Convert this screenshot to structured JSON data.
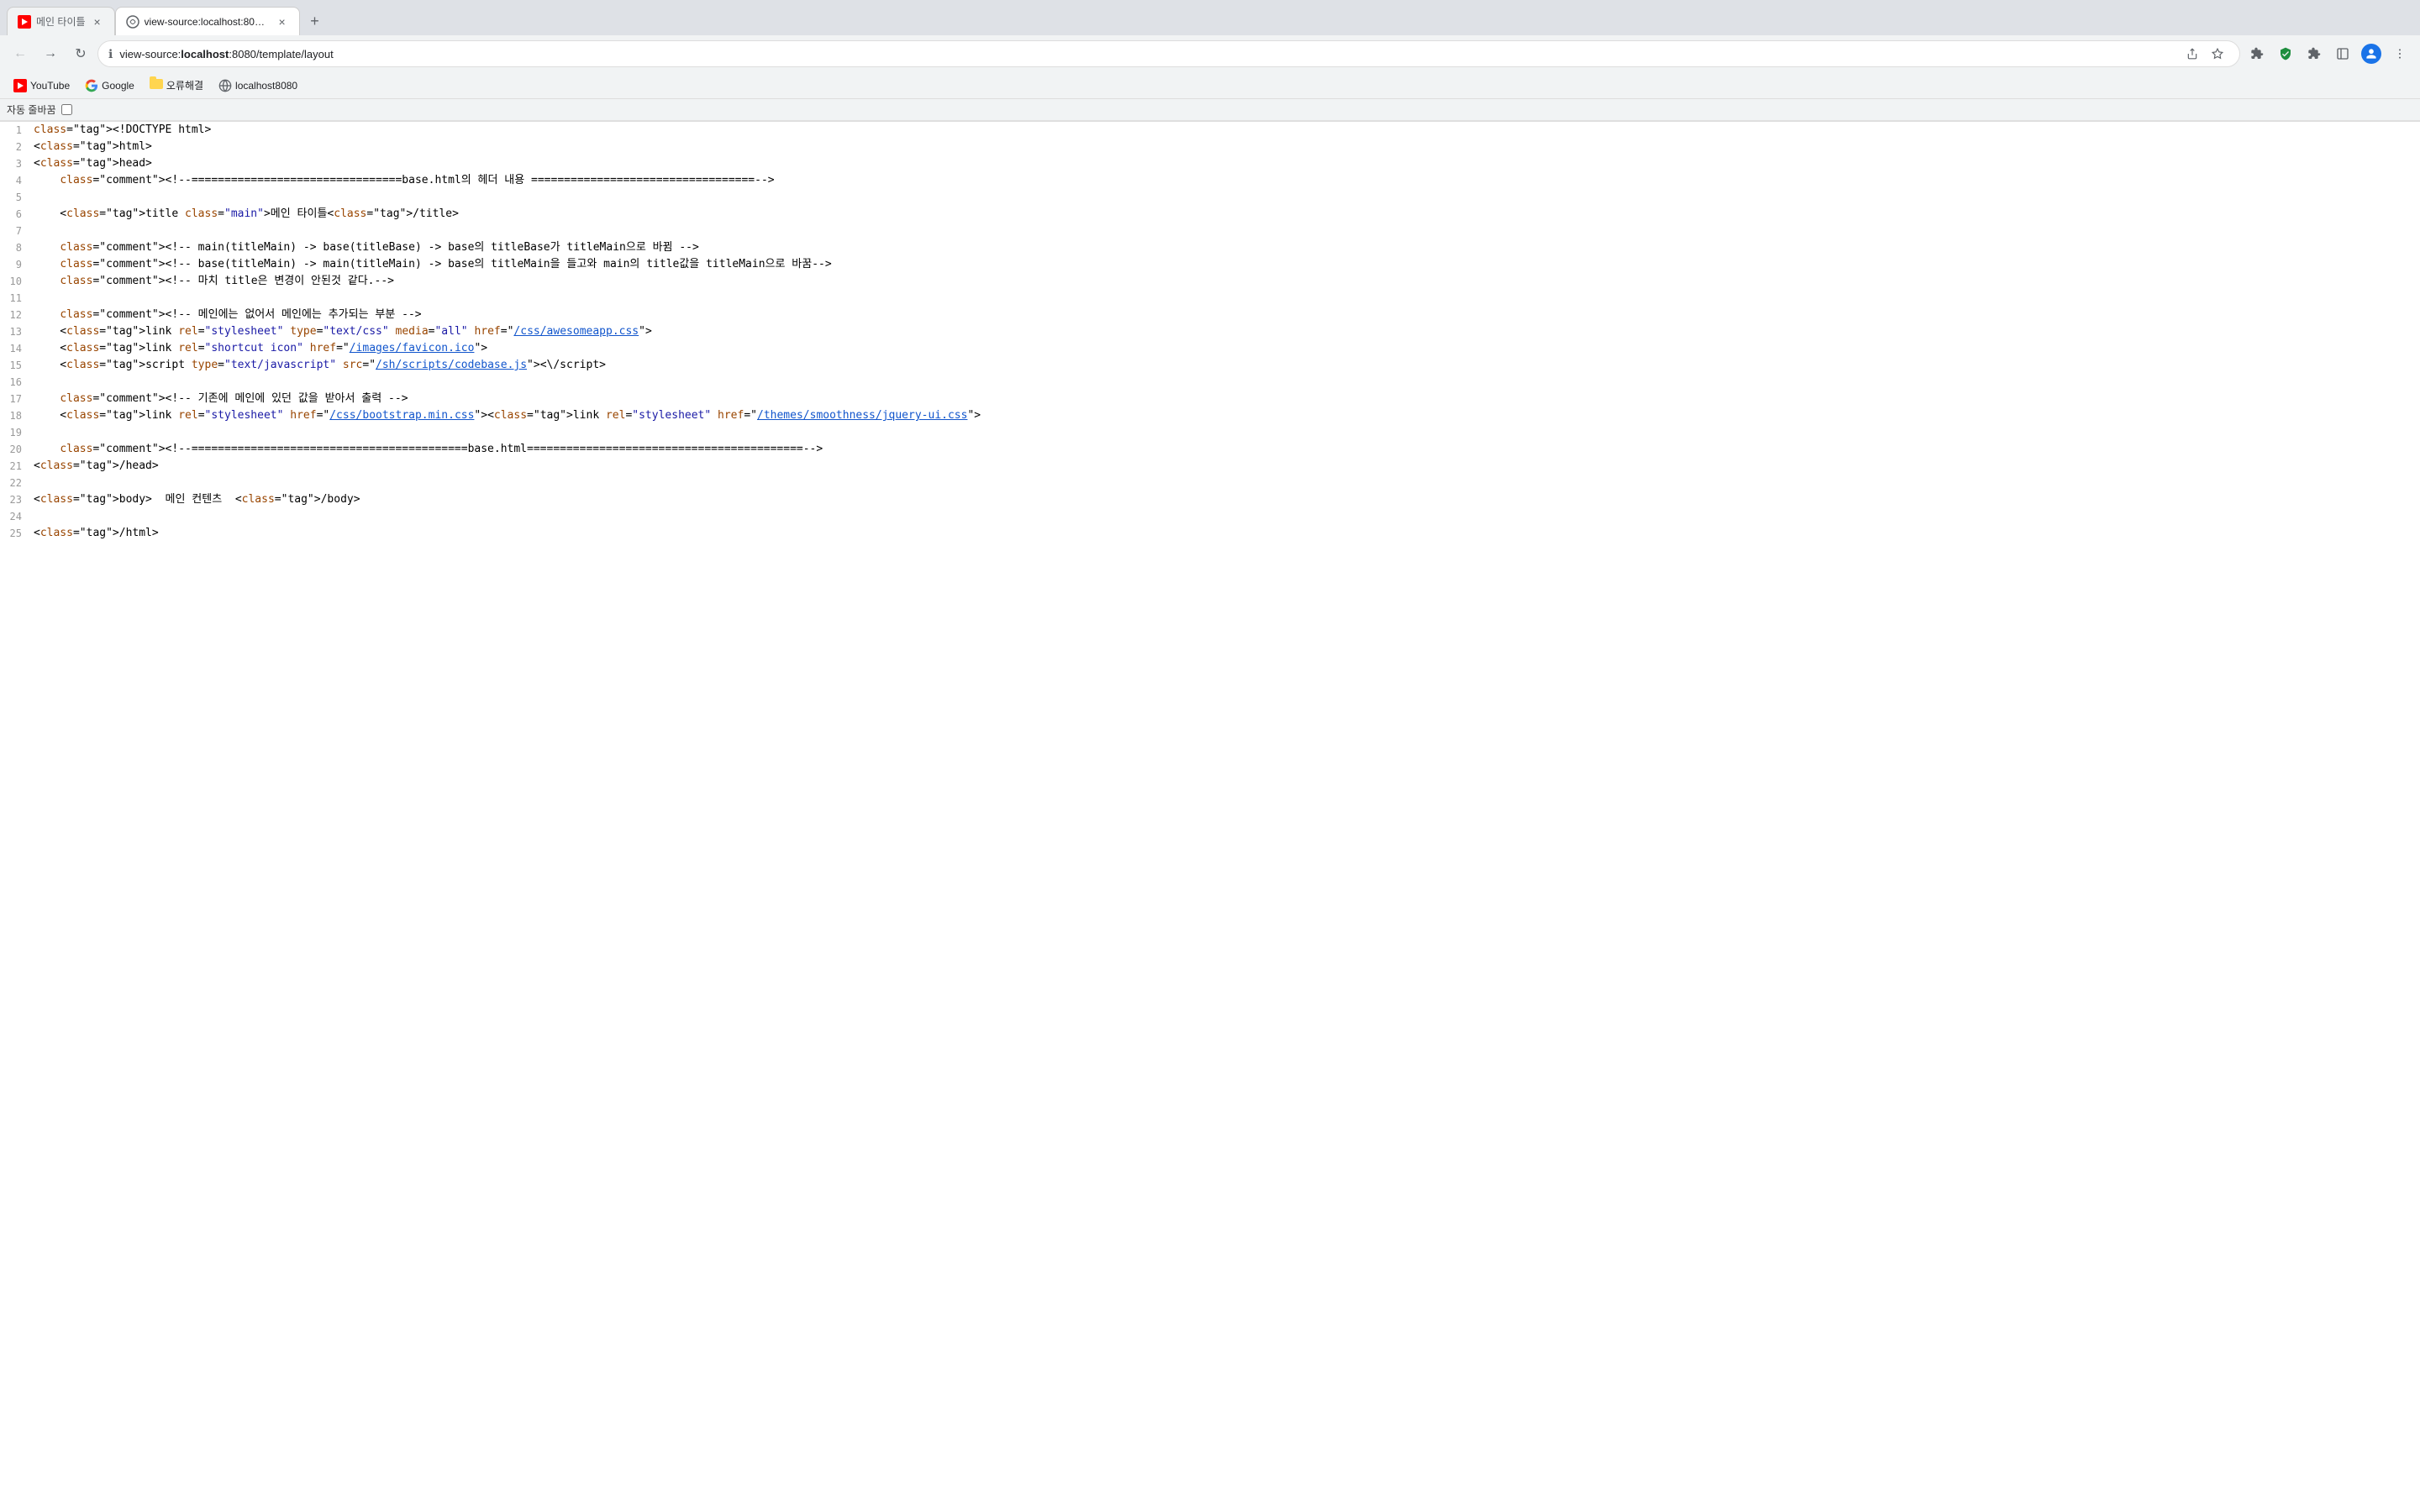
{
  "browser": {
    "tabs": [
      {
        "id": "tab1",
        "title": "메인 타이틀",
        "favicon_type": "youtube",
        "active": false,
        "url": ""
      },
      {
        "id": "tab2",
        "title": "view-source:localhost:8080/t...",
        "favicon_type": "viewsource",
        "active": true,
        "url": "view-source:localhost:8080/template/layout"
      }
    ],
    "address_bar": {
      "prefix": "view-source:",
      "hostname": "localhost",
      "path": ":8080/template/layout"
    },
    "bookmarks": [
      {
        "label": "YouTube",
        "favicon_type": "youtube"
      },
      {
        "label": "Google",
        "favicon_type": "google"
      },
      {
        "label": "오류해결",
        "favicon_type": "folder"
      },
      {
        "label": "localhost8080",
        "favicon_type": "localhost"
      }
    ],
    "autowrap": {
      "label": "자동 줄바꿈",
      "checked": false
    }
  },
  "source": {
    "lines": [
      {
        "num": 1,
        "content": "<!DOCTYPE html>"
      },
      {
        "num": 2,
        "content": "<html>"
      },
      {
        "num": 3,
        "content": "<head>"
      },
      {
        "num": 4,
        "content": "    <!--================================base.html의 헤더 내용 ==================================-->"
      },
      {
        "num": 5,
        "content": ""
      },
      {
        "num": 6,
        "content": "    <title class=\"main\">메인 타이틀</title>"
      },
      {
        "num": 7,
        "content": ""
      },
      {
        "num": 8,
        "content": "    <!-- main(titleMain) -> base(titleBase) -> base의 titleBase가 titleMain으로 바뀜 -->"
      },
      {
        "num": 9,
        "content": "    <!-- base(titleMain) -> main(titleMain) -> base의 titleMain을 들고와 main의 title값을 titleMain으로 바꿈-->"
      },
      {
        "num": 10,
        "content": "    <!-- 마치 title은 변경이 안된것 같다.-->"
      },
      {
        "num": 11,
        "content": ""
      },
      {
        "num": 12,
        "content": "    <!-- 메인에는 없어서 메인에는 추가되는 부분 -->"
      },
      {
        "num": 13,
        "content": "    <link rel=\"stylesheet\" type=\"text/css\" media=\"all\" href=\"/css/awesomeapp.css\">"
      },
      {
        "num": 14,
        "content": "    <link rel=\"shortcut icon\" href=\"/images/favicon.ico\">"
      },
      {
        "num": 15,
        "content": "    <script type=\"text/javascript\" src=\"/sh/scripts/codebase.js\"><\\/script>"
      },
      {
        "num": 16,
        "content": ""
      },
      {
        "num": 17,
        "content": "    <!-- 기존에 메인에 있던 값을 받아서 출력 -->"
      },
      {
        "num": 18,
        "content": "    <link rel=\"stylesheet\" href=\"/css/bootstrap.min.css\"><link rel=\"stylesheet\" href=\"/themes/smoothness/jquery-ui.css\">"
      },
      {
        "num": 19,
        "content": ""
      },
      {
        "num": 20,
        "content": "    <!--==========================================base.html==========================================-->"
      },
      {
        "num": 21,
        "content": "</head>"
      },
      {
        "num": 22,
        "content": ""
      },
      {
        "num": 23,
        "content": "<body>  메인 컨텐츠  </body>"
      },
      {
        "num": 24,
        "content": ""
      },
      {
        "num": 25,
        "content": "</html>"
      }
    ]
  }
}
